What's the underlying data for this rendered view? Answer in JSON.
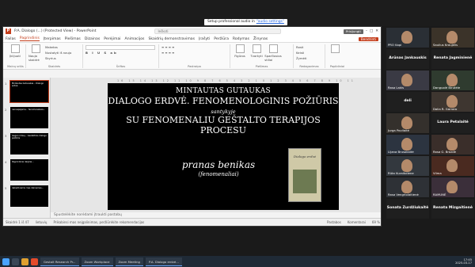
{
  "zoom": {
    "notice_text": "Setup professional audio in",
    "notice_link": "\"audio settings\""
  },
  "ppt": {
    "app_letter": "P",
    "title": "P.A. Dialogo (...) (Protected View) - PowerPoint",
    "search_placeholder": "Ieškoti",
    "tb_pill": "Prisijungti",
    "menu": [
      "Failas",
      "Pagrindinis",
      "Įterpimas",
      "Piešimas",
      "Dizainas",
      "Perėjimai",
      "Animacijos",
      "Skaidrių demonstravimas",
      "Įrašyti",
      "Peržiūra",
      "Rodymas",
      "Žinynas"
    ],
    "menu_active": "Pagrindinis",
    "share_btn": "Bendrinti",
    "ribbon": {
      "clipboard": {
        "paste": "Įklijuoti",
        "label": "Mainų sritis"
      },
      "slides": {
        "new": "Nauja skaidrė",
        "small": [
          "Maketas",
          "Nustatyti iš naujo",
          "Skyrius"
        ],
        "label": "Skaidrės"
      },
      "font": {
        "label": "Šriftas"
      },
      "paragraph": {
        "label": "Pastraipa"
      },
      "drawing": {
        "items": [
          "Figūros",
          "Tvarkyti",
          "Sparčiosios stiliai"
        ],
        "label": "Piešimas"
      },
      "editing": {
        "items": [
          "Rasti",
          "Keisti",
          "Žymėti"
        ],
        "label": "Redagavimas"
      },
      "designer": {
        "label": "Papildiniai"
      }
    },
    "thumbnails": [
      {
        "num": "1",
        "text": "Mintautas Gutauskas – Dialogo erdvė"
      },
      {
        "num": "2",
        "text": "nenuspėjama... fenomenalusis..."
      },
      {
        "num": "3",
        "text": "Gegen mūsų... Gestaltinis dialogo požiūris"
      },
      {
        "num": "4",
        "text": "Pagrindiniai dalykai..."
      },
      {
        "num": "5",
        "text": "dabartinėmis mes dalinames..."
      }
    ],
    "ruler": "16 15 14 13 12 11 10 9 8 7 6 5 4 3 2 1 0 1 2 3 4 5 6 7 8 9 10 11 12 13 14 15 16",
    "slide": {
      "author": "MINTAUTAS GUTAUKAS",
      "title": "DIALOGO ERDVĖ. FENOMENOLOGINIS POŽIŪRIS",
      "context": "santykyje",
      "subtitle": "SU FENOMENALIU GEŠTALTO TERAPIJOS PROCESU",
      "presenter": "pranas benikas",
      "role": "(fenomenaliai)",
      "book_title": "Dialogo erdvė"
    },
    "notes_placeholder": "Spustelėkite norėdami įtraukti pastabų",
    "status": {
      "slide": "Skaidrė 1 iš 47",
      "lang": "lietuvių",
      "view_notes": "Pastabos",
      "comments": "Komentarai",
      "zoom": "69 %",
      "protected": "Prikabinsi mas neįgalinimas, peržiūrėkite rekomendacijas"
    }
  },
  "gallery": [
    {
      "name": "PRO Kapi",
      "kind": "face"
    },
    {
      "name": "Saulius Kraujelis",
      "kind": "face"
    },
    {
      "name": "Arūnas Jankauskis",
      "kind": "text"
    },
    {
      "name": "Renata Jagminienė",
      "kind": "text"
    },
    {
      "name": "Rasa Lakis",
      "kind": "face"
    },
    {
      "name": "Danguolė Birutėle",
      "kind": "face"
    },
    {
      "name": "deli",
      "kind": "text"
    },
    {
      "name": "Dalia R. Garraro",
      "kind": "face"
    },
    {
      "name": "Jurga Povilaitė",
      "kind": "face"
    },
    {
      "name": "Laura Petalaitė",
      "kind": "text"
    },
    {
      "name": "Lijana Brusokaitė",
      "kind": "face"
    },
    {
      "name": "Rasa G. Brazdė",
      "kind": "face"
    },
    {
      "name": "Rūta Kuraitoliene",
      "kind": "face"
    },
    {
      "name": "Vilma",
      "kind": "face"
    },
    {
      "name": "Rasa Vengriolaitienė",
      "kind": "face"
    },
    {
      "name": "RAMUNĖ",
      "kind": "face"
    },
    {
      "name": "Sonata Zurdžiukaitė",
      "kind": "text"
    },
    {
      "name": "Renata Mizgaitienė",
      "kind": "text"
    }
  ],
  "taskbar": {
    "apps": [
      "Gestalt Research Pr...",
      "Zoom Workplace",
      "Zoom Meeting",
      "P.A. Dialogo erdvė..."
    ],
    "time": "17:45",
    "date": "2025-03-17"
  }
}
